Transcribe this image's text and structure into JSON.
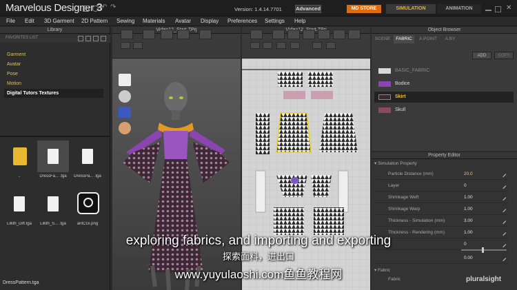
{
  "titlebar": {
    "app_name": "Marvelous Designer",
    "app_version_num": "3",
    "version_label": "Version:  1.4.14.7701",
    "mode_button": "Advanced",
    "store_button": "MD STORE",
    "tab_simulation": "SIMULATION",
    "tab_animation": "ANIMATION"
  },
  "menu": [
    "File",
    "Edit",
    "3D Garment",
    "2D Pattern",
    "Sewing",
    "Materials",
    "Avatar",
    "Display",
    "Preferences",
    "Settings",
    "Help"
  ],
  "library": {
    "title": "Library",
    "favorites_label": "FAVORITES LIST",
    "items": [
      "Garment",
      "Avatar",
      "Pose",
      "Motion",
      "Digital Tutors Textures"
    ],
    "files": [
      "..",
      "DressFa... .tga",
      "DressPa... .tga",
      "Lillith_Diff.tga",
      "Lillith_S... .tga",
      "antCGi.png"
    ]
  },
  "viewport3d": {
    "title": "Video12_Start.ZPrj"
  },
  "viewport2d": {
    "title": "Video12_Start.ZPrj"
  },
  "object_browser": {
    "title": "Object Browser",
    "tabs": [
      "SCENE",
      "FABRIC",
      "A.POINT",
      "A.BY"
    ],
    "add_button": "ADD",
    "copy_button": "COPY",
    "fabrics": [
      {
        "name": "BASIC_FABRIC",
        "color": "#d8d8d8"
      },
      {
        "name": "Bodice",
        "color": "#8a45b0"
      },
      {
        "name": "Skirt",
        "color": "#3a2a30"
      },
      {
        "name": "Skull",
        "color": "#8a4a5a"
      }
    ]
  },
  "property_editor": {
    "title": "Property Editor",
    "section": "Simulation Property",
    "rows": [
      {
        "label": "Particle Distance (mm)",
        "value": "20.0"
      },
      {
        "label": "Layer",
        "value": "0"
      },
      {
        "label": "Shrinkage Weft",
        "value": "1.00"
      },
      {
        "label": "Shrinkage Warp",
        "value": "1.00"
      },
      {
        "label": "Thickness - Simulation (mm)",
        "value": "3.00"
      },
      {
        "label": "Thickness - Rendering (mm)",
        "value": "1.00"
      },
      {
        "label": "",
        "value": "0"
      },
      {
        "label": "",
        "value": "0.00"
      }
    ],
    "fabric_section": "Fabric",
    "fabric_label": "Fabric"
  },
  "subtitles": {
    "english": "exploring fabrics, and importing and exporting",
    "chinese": "探索面料，进出口",
    "website": "www.yuyulaoshi.com鱼鱼教程网"
  },
  "status": {
    "file": "DressPattern.tga"
  },
  "watermark": "pluralsight"
}
